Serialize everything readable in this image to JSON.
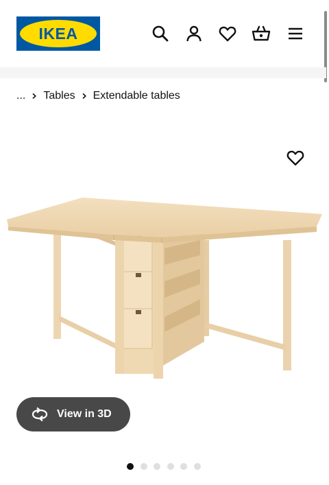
{
  "header": {
    "logo_text": "IKEA",
    "icons": [
      "search-icon",
      "user-icon",
      "heart-icon",
      "basket-icon",
      "menu-icon"
    ]
  },
  "breadcrumb": {
    "ellipsis": "...",
    "items": [
      "Tables",
      "Extendable tables"
    ]
  },
  "product": {
    "view3d_label": "View in 3D",
    "carousel": {
      "total": 6,
      "active": 1
    }
  },
  "colors": {
    "brand_blue": "#0058a3",
    "brand_yellow": "#ffdb00",
    "button_dark": "#484848",
    "dot_active": "#111111",
    "dot_inactive": "#dfdfdf",
    "wood": "#f0d8b2"
  }
}
